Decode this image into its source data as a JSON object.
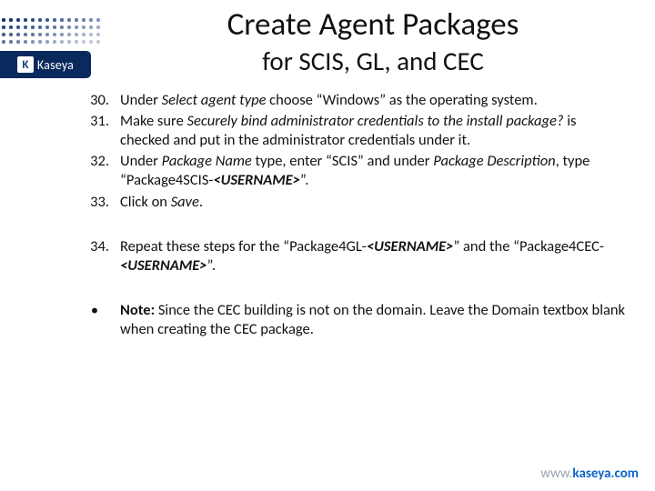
{
  "logo": {
    "brand": "Kaseya",
    "k": "K"
  },
  "title": {
    "main": "Create Agent Packages",
    "sub": "for SCIS, GL, and CEC"
  },
  "items": {
    "n30": "30.",
    "t30a": "Under ",
    "t30b": "Select agent type",
    "t30c": " choose “Windows” as the operating system.",
    "n31": "31.",
    "t31a": "Make sure ",
    "t31b": "Securely bind administrator credentials to the install package?",
    "t31c": " is checked and put in the administrator credentials under it.",
    "n32": "32.",
    "t32a": "Under ",
    "t32b": "Package Name",
    "t32c": " type, enter “SCIS” and under ",
    "t32d": "Package Description",
    "t32e": ", type “Package4SCIS-",
    "t32f": "<USERNAME>",
    "t32g": "”.",
    "n33": "33.",
    "t33a": "Click on ",
    "t33b": "Save",
    "t33c": ".",
    "n34": "34.",
    "t34a": "Repeat these steps for the “Package4GL-",
    "t34b": "<USERNAME>",
    "t34c": "” and the “Package4CEC-",
    "t34d": "<USERNAME>",
    "t34e": "”.",
    "bullet": "•",
    "note1": "Note:",
    "note2": " Since the CEC building is not on the domain. Leave the Domain textbox blank when creating the CEC package."
  },
  "footer": {
    "www": "www.",
    "main": "kaseya.com"
  }
}
